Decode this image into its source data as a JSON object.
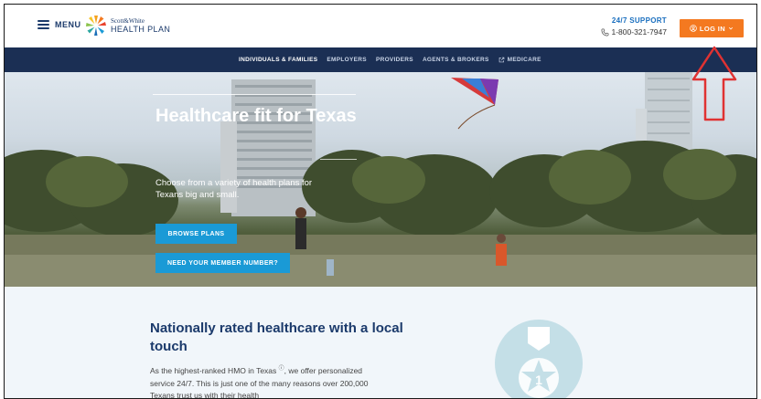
{
  "header": {
    "menu_label": "MENU",
    "logo_line1": "Scott&White",
    "logo_line2": "HEALTH PLAN",
    "support_title": "24/7 SUPPORT",
    "support_phone": "1-800-321-7947",
    "login_label": "LOG IN"
  },
  "nav": {
    "items": [
      {
        "label": "INDIVIDUALS & FAMILIES"
      },
      {
        "label": "EMPLOYERS"
      },
      {
        "label": "PROVIDERS"
      },
      {
        "label": "AGENTS & BROKERS"
      },
      {
        "label": "MEDICARE"
      }
    ]
  },
  "hero": {
    "title": "Healthcare fit for Texas",
    "subtitle": "Choose from a variety of health plans for Texans big and small.",
    "browse_button": "BROWSE PLANS",
    "member_button": "NEED YOUR MEMBER NUMBER?"
  },
  "section": {
    "title": "Nationally rated healthcare with a local touch",
    "body_part1": "As the highest-ranked HMO in Texas",
    "body_part2": ", we offer personalized service 24/7. This is just one of the many reasons over 200,000 Texans trust us with their health",
    "info_marker": "i",
    "medal_number": "1"
  },
  "colors": {
    "brand_navy": "#1b2f54",
    "login_orange": "#f47920",
    "button_blue": "#1a9ad6",
    "annotation_red": "#e03232"
  }
}
